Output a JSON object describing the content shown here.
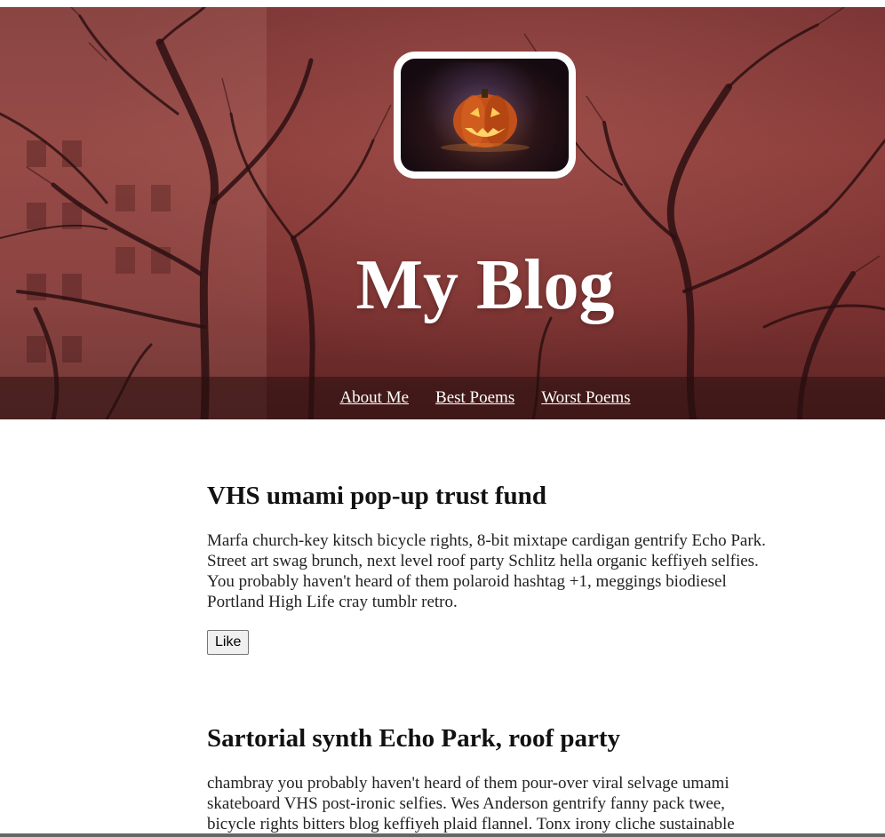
{
  "header": {
    "title": "My Blog",
    "nav": [
      "About Me",
      "Best Poems",
      "Worst Poems"
    ]
  },
  "posts": [
    {
      "title": "VHS umami pop-up trust fund",
      "body": "Marfa church-key kitsch bicycle rights, 8-bit mixtape cardigan gentrify Echo Park. Street art swag brunch, next level roof party Schlitz hella organic keffiyeh selfies. You probably haven't heard of them polaroid hashtag +1, meggings biodiesel Portland High Life cray tumblr retro.",
      "like_label": "Like"
    },
    {
      "title": "Sartorial synth Echo Park, roof party",
      "body": "chambray you probably haven't heard of them pour-over viral selvage umami skateboard VHS post-ironic selfies. Wes Anderson gentrify fanny pack twee, bicycle rights bitters blog keffiyeh plaid flannel. Tonx irony cliche sustainable"
    }
  ],
  "colors": {
    "hero_tint": "#7a3434",
    "nav_bg": "#2a1212",
    "text": "#111111"
  },
  "icons": {
    "header_image": "jack-o-lantern-photo"
  }
}
